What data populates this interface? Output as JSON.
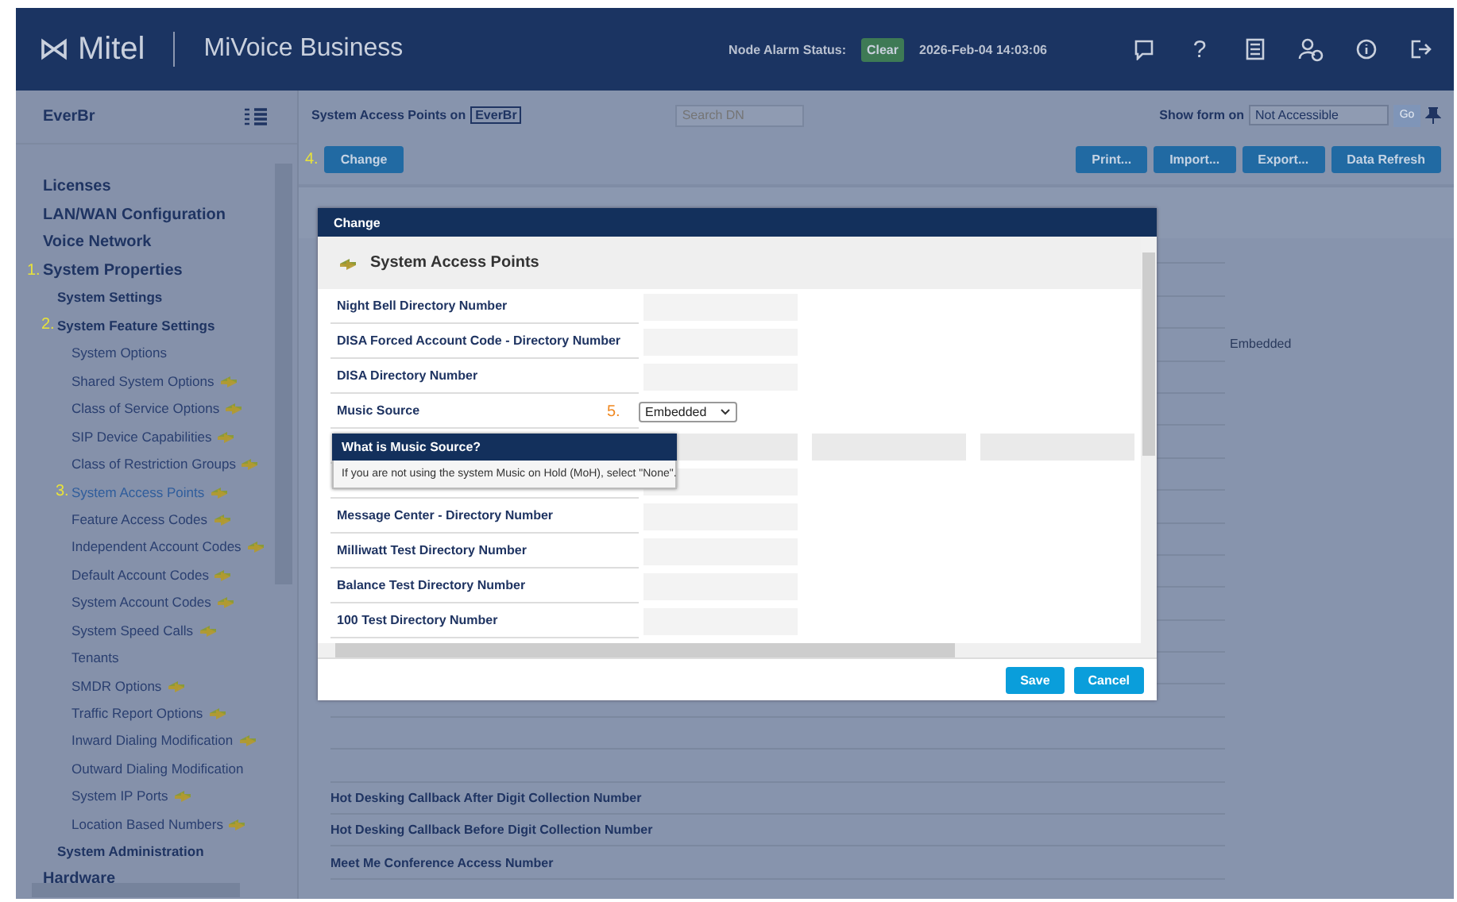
{
  "header": {
    "logo": "Mitel",
    "product": "MiVoice Business",
    "alarm_label": "Node Alarm Status:",
    "alarm_status": "Clear",
    "datetime": "2026-Feb-04 14:03:06",
    "help": "?"
  },
  "sidebar": {
    "title": "EverBr",
    "items": [
      {
        "label": "Licenses"
      },
      {
        "label": "LAN/WAN Configuration"
      },
      {
        "label": "Voice Network"
      },
      {
        "label": "System Properties",
        "step": "1.",
        "children": [
          {
            "label": "System Settings"
          },
          {
            "label": "System Feature Settings",
            "step": "2.",
            "children": [
              {
                "label": "System Options",
                "selected": false,
                "shared": false
              },
              {
                "label": "Shared System Options",
                "selected": false,
                "shared": true
              },
              {
                "label": "Class of Service Options",
                "selected": false,
                "shared": true
              },
              {
                "label": "SIP Device Capabilities",
                "selected": false,
                "shared": true
              },
              {
                "label": "Class of Restriction Groups",
                "selected": false,
                "shared": true
              },
              {
                "label": "System Access Points",
                "step": "3.",
                "selected": true,
                "shared": true
              },
              {
                "label": "Feature Access Codes",
                "selected": false,
                "shared": true
              },
              {
                "label": "Independent Account Codes",
                "selected": false,
                "shared": true
              },
              {
                "label": "Default Account Codes",
                "selected": false,
                "shared": true
              },
              {
                "label": "System Account Codes",
                "selected": false,
                "shared": true
              },
              {
                "label": "System Speed Calls",
                "selected": false,
                "shared": true
              },
              {
                "label": "Tenants",
                "selected": false,
                "shared": false
              },
              {
                "label": "SMDR Options",
                "selected": false,
                "shared": true
              },
              {
                "label": "Traffic Report Options",
                "selected": false,
                "shared": true
              },
              {
                "label": "Inward Dialing Modification",
                "selected": false,
                "shared": true
              },
              {
                "label": "Outward Dialing Modification",
                "selected": false,
                "shared": false
              },
              {
                "label": "System IP Ports",
                "selected": false,
                "shared": true
              },
              {
                "label": "Location Based Numbers",
                "selected": false,
                "shared": true
              }
            ]
          },
          {
            "label": "System Administration"
          }
        ]
      },
      {
        "label": "Hardware"
      }
    ]
  },
  "toolbar": {
    "form_title": "System Access Points on",
    "node": "EverBr",
    "search": {
      "placeholder": "Search DN"
    },
    "show_form_label": "Show form on",
    "show_form_value": "Not Accessible",
    "go_button": {
      "label": "Go",
      "disabled": true
    }
  },
  "actions": {
    "step": "4.",
    "change": "Change",
    "buttons": [
      "Print...",
      "Import...",
      "Export...",
      "Data Refresh"
    ]
  },
  "background_rows": [
    {
      "value": "Embedded"
    },
    {
      "label": "Hot Desking Callback After Digit Collection Number"
    },
    {
      "label": "Hot Desking Callback Before Digit Collection Number"
    },
    {
      "label": "Meet Me Conference Access Number"
    }
  ],
  "dialog": {
    "title": "Change",
    "section": "System Access Points",
    "fields": [
      {
        "kind": "text",
        "label": "Night Bell Directory Number"
      },
      {
        "kind": "text",
        "label": "DISA Forced Account Code - Directory Number"
      },
      {
        "kind": "text",
        "label": "DISA Directory Number"
      },
      {
        "kind": "select",
        "label": "Music Source",
        "step": "5.",
        "value": "Embedded"
      },
      {
        "kind": "triple"
      },
      {
        "kind": "text"
      },
      {
        "kind": "text",
        "label": "Message Center - Directory Number"
      },
      {
        "kind": "text",
        "label": "Milliwatt Test Directory Number"
      },
      {
        "kind": "text",
        "label": "Balance Test Directory Number"
      },
      {
        "kind": "text",
        "label": "100 Test Directory Number"
      }
    ],
    "tooltip": {
      "title": "What is Music Source?",
      "text": "If you are not using the system Music on Hold (MoH), select \"None\"."
    },
    "buttons": [
      "Save",
      "Cancel"
    ]
  }
}
